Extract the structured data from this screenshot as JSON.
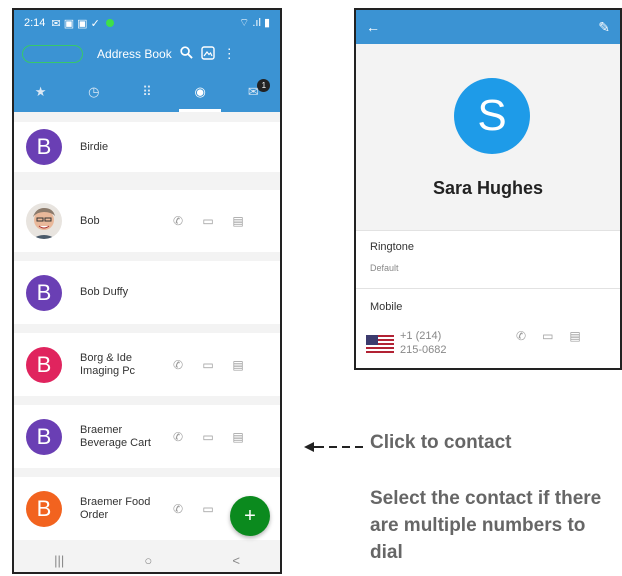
{
  "left_phone": {
    "status": {
      "time": "2:14",
      "icons": "✉ ▣ ▣ ✓",
      "right_icons": "⌔ .ıl ▮"
    },
    "toolbar": {
      "pill_label": "",
      "title": "Address Book"
    },
    "tabs": [
      {
        "icon": "★",
        "name": "favorites"
      },
      {
        "icon": "◷",
        "name": "recents"
      },
      {
        "icon": "⠿",
        "name": "dialpad"
      },
      {
        "icon": "◉",
        "name": "contacts"
      },
      {
        "icon": "✉",
        "name": "messages",
        "badge": "1"
      }
    ],
    "contacts": [
      {
        "initial": "B",
        "name": "Birdie",
        "color": "#6a3fb4"
      },
      {
        "initial": "",
        "name": "Bob",
        "photo": true
      },
      {
        "initial": "B",
        "name": "Bob Duffy",
        "color": "#6a3fb4"
      },
      {
        "initial": "B",
        "name": "Borg & Ide Imaging Pc",
        "color": "#e0245e"
      },
      {
        "initial": "B",
        "name": "Braemer Beverage Cart",
        "color": "#6a3fb4"
      },
      {
        "initial": "B",
        "name": "Braemer Food Order",
        "color": "#f2631f"
      }
    ],
    "fab_label": "+",
    "nav": [
      "|||",
      "○",
      "<"
    ]
  },
  "right_phone": {
    "initial": "S",
    "name": "Sara Hughes",
    "ringtone_label": "Ringtone",
    "ringtone_value": "Default",
    "mobile_label": "Mobile",
    "phone_line1": "+1 (214)",
    "phone_line2": "215-0682"
  },
  "annotations": {
    "click_to_contact": "Click to contact",
    "select_contact": "Select the contact if there are multiple numbers to dial"
  },
  "colors": {
    "header_blue": "#3b93d3",
    "fab_green": "#0b8a1e",
    "avatar_blue": "#1e9be8"
  }
}
